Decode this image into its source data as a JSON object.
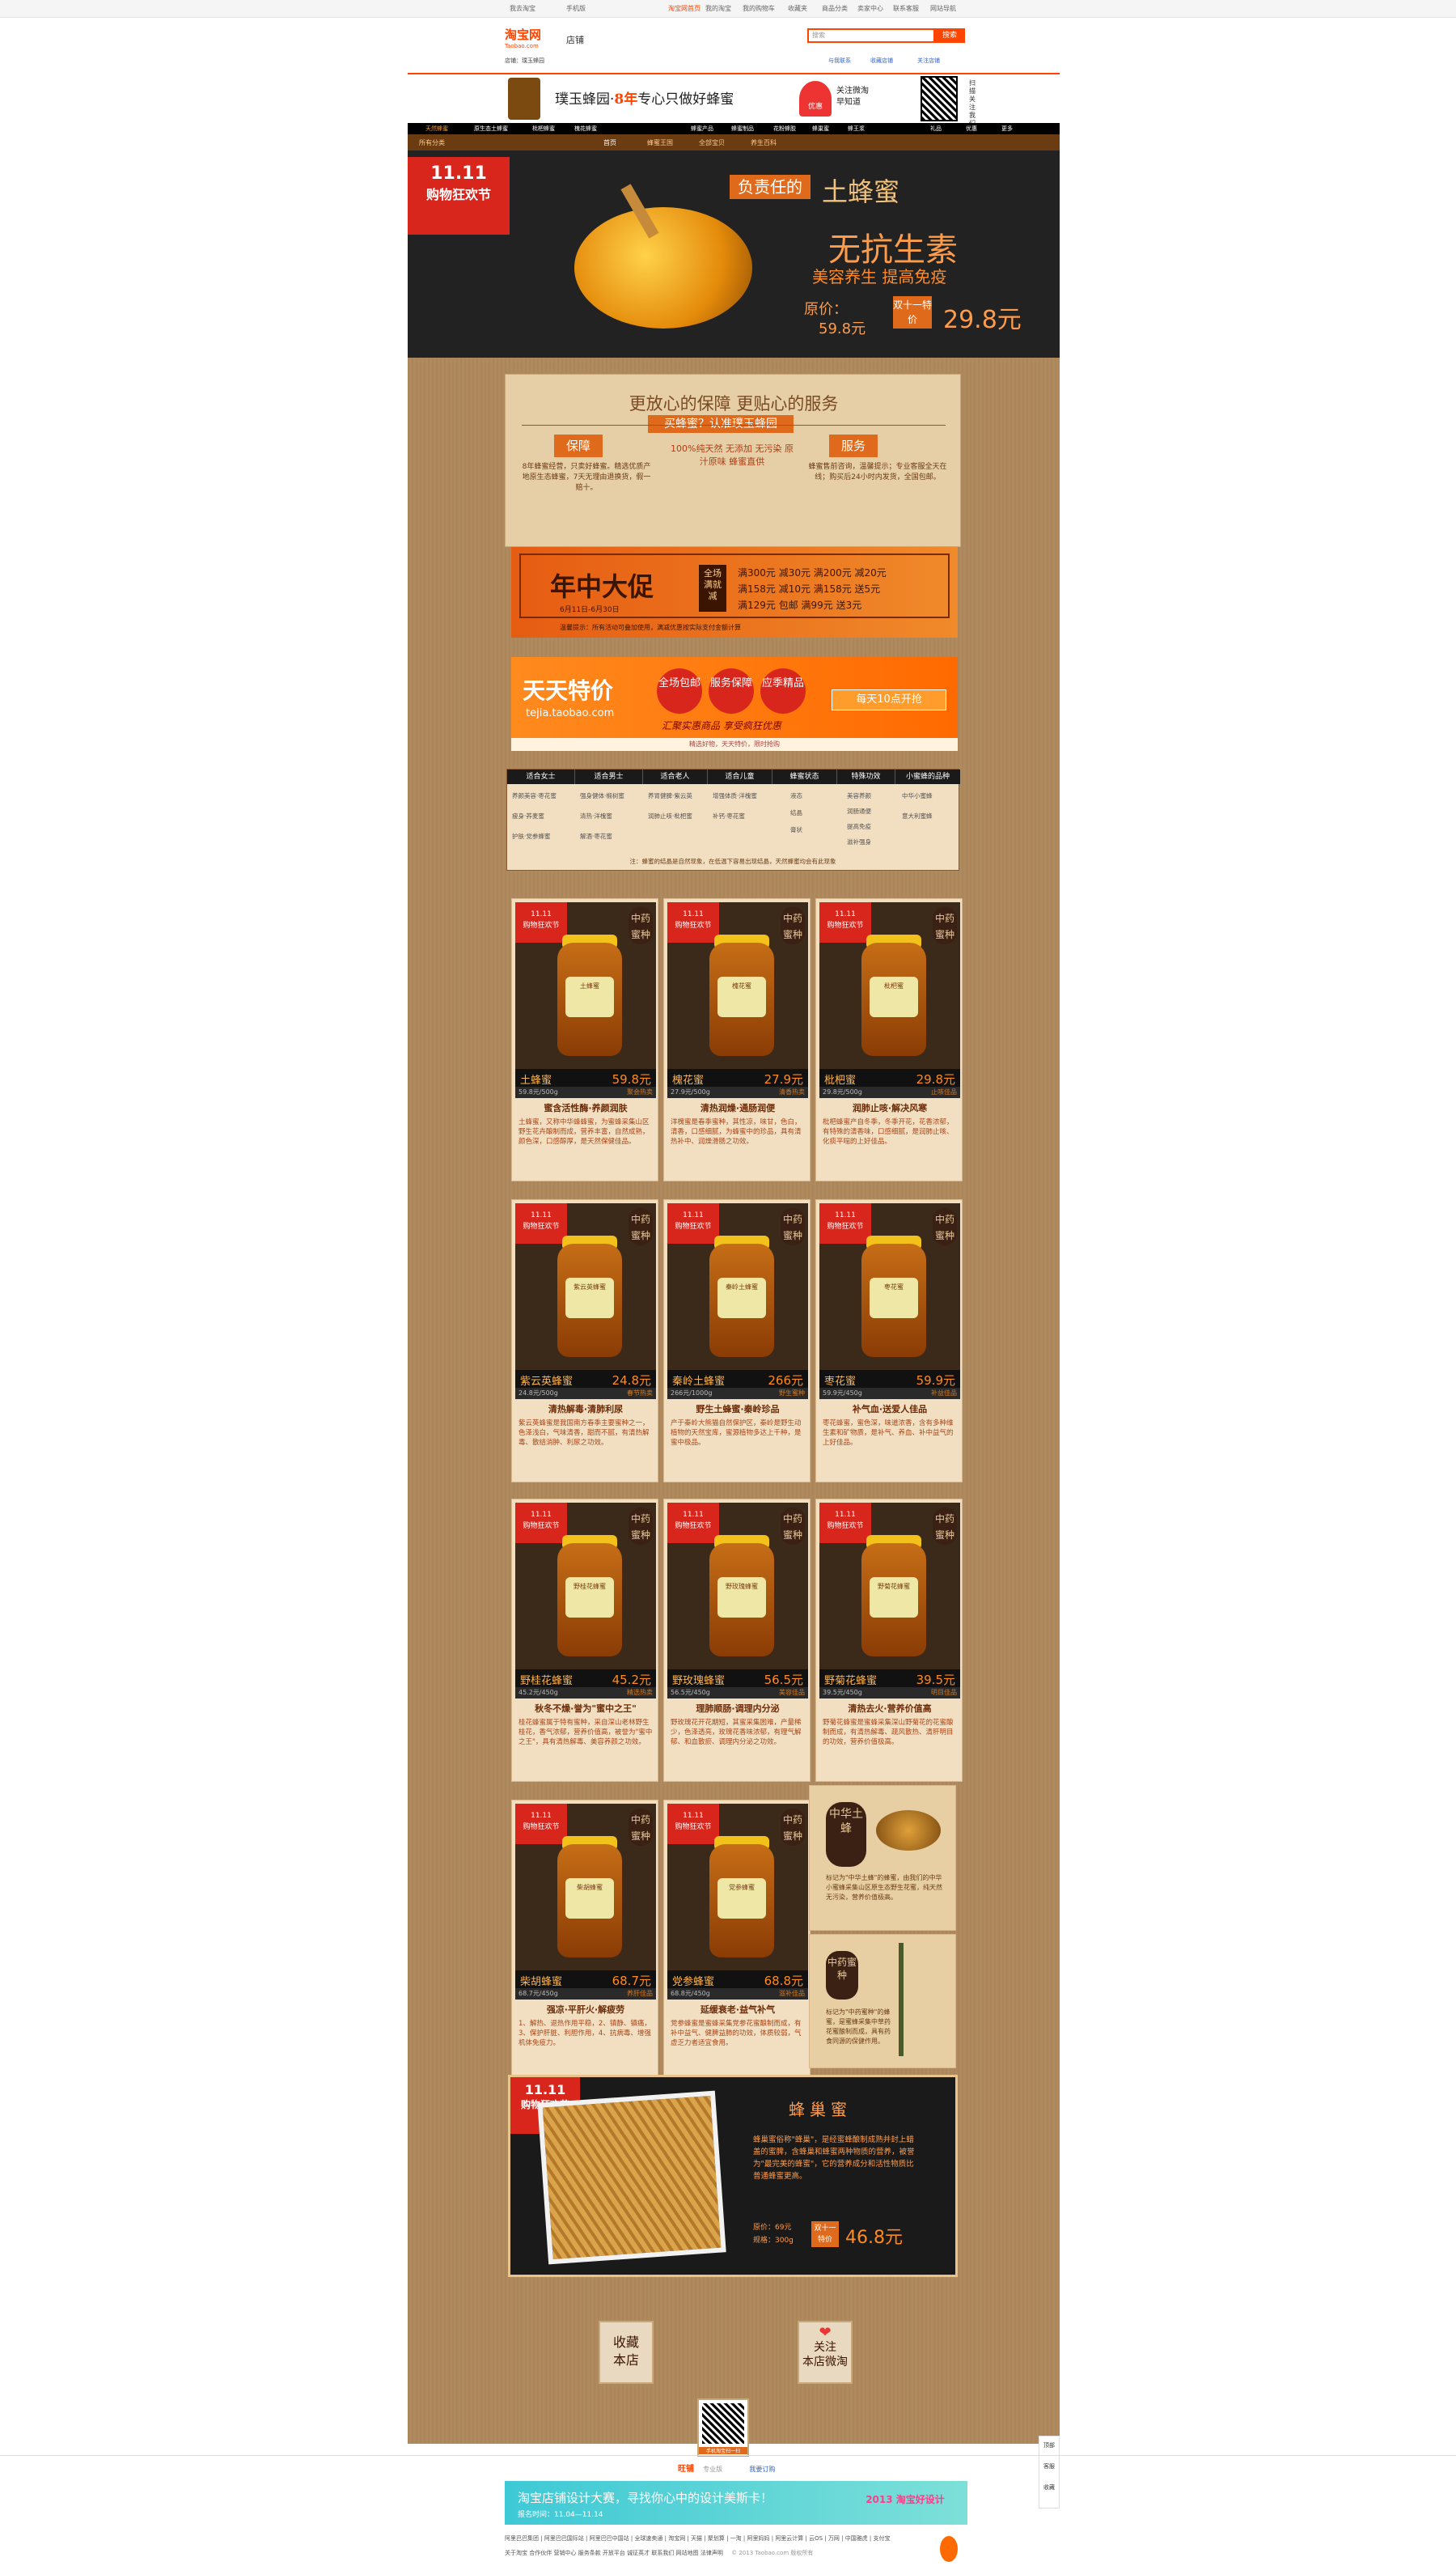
{
  "topbar": {
    "left": [
      "我去淘宝",
      "手机版"
    ],
    "right": [
      "淘宝网首页",
      "我的淘宝",
      "我的购物车",
      "收藏夹",
      "商品分类",
      "卖家中心",
      "联系客服",
      "网站导航"
    ]
  },
  "header": {
    "logo": "淘宝网",
    "logo_sub": "Taobao.com",
    "shop_label": "店铺",
    "search_placeholder": "搜索",
    "search_button": "搜索",
    "info_line": "店铺：璞玉蜂园",
    "contact_1": "与我联系",
    "contact_2": "收藏店铺",
    "contact_3": "关注店铺"
  },
  "shop": {
    "slogan_pre": "璞玉蜂园·",
    "slogan_num": "8年",
    "slogan_post": "专心只做好蜂蜜",
    "weibo_line1": "关注微淘",
    "weibo_line2": "早知道",
    "weibo_badge": "优惠",
    "qr_caption": "扫描关注我们"
  },
  "navbar": {
    "items": [
      "天然蜂蜜",
      "原生态土蜂蜜",
      "枇杷蜂蜜",
      "槐花蜂蜜",
      "蜂蜜产品",
      "蜂蜜制品",
      "花粉蜂胶",
      "蜂巢蜜",
      "蜂王浆",
      "礼品",
      "优惠",
      "更多"
    ]
  },
  "subnav": {
    "items": [
      "所有分类",
      "首页",
      "蜂蜜王国",
      "全部宝贝",
      "养生百科"
    ]
  },
  "hero": {
    "badge_top": "11.11",
    "badge_mid": "购物狂欢节",
    "tag": "负责任的",
    "title": "土蜂蜜",
    "big": "无抗生素",
    "sub": "美容养生 提高免疫",
    "orig_label": "原价：",
    "orig_price": "59.8元",
    "promo_label": "双十一特价",
    "promo_price": "29.8元"
  },
  "service": {
    "heading": "更放心的保障 更贴心的服务",
    "subheading": "买蜂蜜？认准璞玉蜂园",
    "left_title": "保障",
    "right_title": "服务",
    "left_text": "8年蜂蜜经营，只卖好蜂蜜。精选优质产地原生态蜂蜜，7天无理由退换货，假一赔十。",
    "center_text": "100%纯天然 无添加 无污染 原汁原味 蜂蜜直供",
    "right_text": "蜂蜜售前咨询，温馨提示；专业客服全天在线；购买后24小时内发货，全国包邮。"
  },
  "promo": {
    "title": "年中大促",
    "date": "6月11日-6月30日",
    "stamp": "全场满就减",
    "lines": [
      "满300元 减30元 满200元 减20元",
      "满158元 减10元 满158元 送5元",
      "满129元 包邮 满99元 送3元"
    ],
    "footer": "温馨提示：所有活动可叠加使用，满减优惠按实际支付金额计算"
  },
  "tejia": {
    "title": "天天特价",
    "url": "tejia.taobao.com",
    "circles": [
      "全场包邮",
      "服务保障",
      "应季精品"
    ],
    "slogan": "汇聚实惠商品 享受疯狂优惠",
    "button": "每天10点开抢",
    "note": "精选好物，天天特价，限时抢购"
  },
  "table": {
    "headers": [
      "适合女士",
      "适合男士",
      "适合老人",
      "适合儿童",
      "蜂蜜状态",
      "特殊功效",
      "小蜜蜂的品种"
    ],
    "cols": [
      [
        "养颜美容·枣花蜜",
        "瘦身·荞麦蜜",
        "护肤·党参蜂蜜"
      ],
      [
        "强身健体·椴树蜜",
        "清热·洋槐蜜",
        "解酒·枣花蜜"
      ],
      [
        "养胃健脾·紫云英",
        "润肺止咳·枇杷蜜"
      ],
      [
        "增强体质·洋槐蜜",
        "补钙·枣花蜜"
      ],
      [
        "液态",
        "结晶",
        "膏状"
      ],
      [
        "美容养颜",
        "润肠通便",
        "提高免疫",
        "滋补强身"
      ],
      [
        "中华小蜜蜂",
        "意大利蜜蜂"
      ]
    ],
    "footer": "注：蜂蜜的结晶是自然现象，在低温下容易出现结晶，天然蜂蜜均会有此现象"
  },
  "products": [
    {
      "name": "土蜂蜜",
      "price": "59.8元",
      "spec": "59.8元/500g",
      "spec_r": "聚会热卖",
      "title": "蜜含活性酶·养颜润肤",
      "desc": "土蜂蜜，又称中华蜂蜂蜜，为蜜蜂采集山区野生花卉酿制而成，营养丰富，自然成熟，颜色深，口感醇厚，是天然保健佳品。"
    },
    {
      "name": "槐花蜜",
      "price": "27.9元",
      "spec": "27.9元/500g",
      "spec_r": "清香热卖",
      "title": "清热润燥·通肠润便",
      "desc": "洋槐蜜是春季蜜种，其性凉，味甘，色白，清香，口感细腻，为蜂蜜中的珍品，具有清热补中、润燥滑肠之功效。"
    },
    {
      "name": "枇杷蜜",
      "price": "29.8元",
      "spec": "29.8元/500g",
      "spec_r": "止咳佳品",
      "title": "润肺止咳·解决风寒",
      "desc": "枇杷蜂蜜产自冬季，冬季开花，花香浓郁，有特殊的清香味，口感细腻，是润肺止咳、化痰平喘的上好佳品。"
    },
    {
      "name": "紫云英蜂蜜",
      "price": "24.8元",
      "spec": "24.8元/500g",
      "spec_r": "春节热卖",
      "title": "清热解毒·清肺利尿",
      "desc": "紫云英蜂蜜是我国南方春季主要蜜种之一，色泽浅白，气味清香，甜而不腻，有清热解毒、散结消肿、利尿之功效。"
    },
    {
      "name": "秦岭土蜂蜜",
      "price": "266元",
      "spec": "266元/1000g",
      "spec_r": "野生蜜种",
      "title": "野生土蜂蜜·秦岭珍品",
      "desc": "产于秦岭大熊猫自然保护区，秦岭是野生动植物的天然宝库，蜜源植物多达上千种，是蜜中极品。"
    },
    {
      "name": "枣花蜜",
      "price": "59.9元",
      "spec": "59.9元/450g",
      "spec_r": "补益佳品",
      "title": "补气血·送爱人佳品",
      "desc": "枣花蜂蜜，蜜色深，味道浓香，含有多种维生素和矿物质，是补气、养血、补中益气的上好佳品。"
    },
    {
      "name": "野桂花蜂蜜",
      "price": "45.2元",
      "spec": "45.2元/450g",
      "spec_r": "精选热卖",
      "title": "秋冬不燥·誉为\"蜜中之王\"",
      "desc": "桂花蜂蜜属于特有蜜种，采自深山老林野生桂花，香气浓郁，营养价值高，被誉为\"蜜中之王\"，具有清热解毒、美容养颜之功效。"
    },
    {
      "name": "野玫瑰蜂蜜",
      "price": "56.5元",
      "spec": "56.5元/450g",
      "spec_r": "美容佳品",
      "title": "理肺顺肠·调理内分泌",
      "desc": "野玫瑰花开花期短，其蜜采集困难，产量稀少，色泽透亮，玫瑰花香味浓郁，有理气解郁、和血散瘀、调理内分泌之功效。"
    },
    {
      "name": "野菊花蜂蜜",
      "price": "39.5元",
      "spec": "39.5元/450g",
      "spec_r": "明目佳品",
      "title": "清热去火·营养价值高",
      "desc": "野菊花蜂蜜是蜜蜂采集深山野菊花的花蜜酿制而成，有清热解毒、疏风散热、清肝明目的功效，营养价值极高。"
    },
    {
      "name": "柴胡蜂蜜",
      "price": "68.7元",
      "spec": "68.7元/450g",
      "spec_r": "养肝佳品",
      "title": "强凉·平肝火·解疲劳",
      "desc": "1、解热、退热作用平稳，2、镇静、镇痛，3、保护肝脏、利胆作用，4、抗病毒、增强机体免疫力。"
    },
    {
      "name": "党参蜂蜜",
      "price": "68.8元",
      "spec": "68.8元/450g",
      "spec_r": "滋补佳品",
      "title": "延缓衰老·益气补气",
      "desc": "党参蜂蜜是蜜蜂采集党参花蜜酿制而成，有补中益气、健脾益肺的功效，体质较弱，气虚乏力者适宜食用。"
    }
  ],
  "tile_bee": {
    "seal": "中华土蜂",
    "text": "标记为\"中华土蜂\"的蜂蜜，由我们的中华小蜜蜂采集山区原生态野生花蜜，纯天然无污染，营养价值极高。"
  },
  "tile_herb": {
    "seal": "中药蜜种",
    "text": "标记为\"中药蜜种\"的蜂蜜，是蜜蜂采集中草药花蜜酿制而成，具有药食同源的保健作用。"
  },
  "honeycomb": {
    "badge_top": "11.11",
    "badge_mid": "购物狂欢节",
    "title": "蜂巢蜜",
    "desc": "蜂巢蜜俗称\"蜂巢\"，是经蜜蜂酿制成熟并封上蜡盖的蜜脾，含蜂巢和蜂蜜两种物质的营养，被誉为\"最完美的蜂蜜\"，它的营养成分和活性物质比普通蜂蜜更高。",
    "orig_label": "原价：",
    "orig_price": "69元",
    "weight": "规格：300g",
    "promo_label": "双十一特价",
    "price": "46.8元"
  },
  "bottom_buttons": {
    "fav_line1": "收藏",
    "fav_line2": "本店",
    "follow_line1": "关注",
    "follow_line2": "本店微淘"
  },
  "qr_bottom_caption": "手机淘宝扫一扫",
  "sidebar": [
    "顶部",
    "客服",
    "收藏"
  ],
  "footer": {
    "brand": "旺铺",
    "brand_sub": "专业版",
    "brand_link": "我要订购",
    "banner_title": "淘宝店铺设计大赛，寻找你心中的设计美斯卡！",
    "banner_date": "报名时间：11.04—11.14",
    "banner_right": "2013 淘宝好设计",
    "links_1": [
      "阿里巴巴集团",
      "阿里巴巴国际站",
      "阿里巴巴中国站",
      "全球速卖通",
      "淘宝网",
      "天猫",
      "聚划算",
      "一淘",
      "阿里妈妈",
      "阿里云计算",
      "云OS",
      "万网",
      "中国雅虎",
      "支付宝"
    ],
    "links_2": [
      "关于淘宝",
      "合作伙伴",
      "营销中心",
      "服务条款",
      "开放平台",
      "诚征英才",
      "联系我们",
      "网站地图",
      "法律声明"
    ],
    "copyright": "© 2013 Taobao.com 版权所有"
  },
  "colors": {
    "accent": "#ff4400",
    "wood": "#b08a5e",
    "panel": "#e6cfa7",
    "product_price": "#ff8a1e",
    "dark_brown": "#6b3b12"
  }
}
